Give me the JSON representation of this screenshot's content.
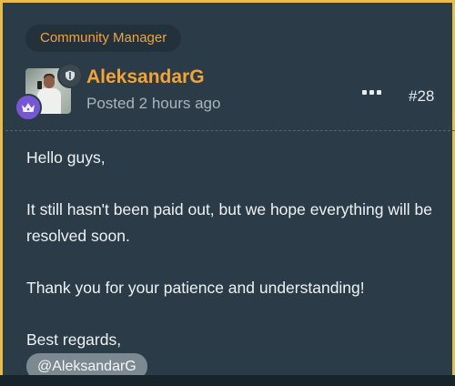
{
  "post": {
    "role_badge": "Community Manager",
    "author": "AleksandarG",
    "posted": "Posted 2 hours ago",
    "post_number": "#28",
    "body": {
      "greeting": "Hello guys,",
      "line1": "It still hasn't been paid out, but we hope everything will be resolved soon.",
      "line2": "Thank you for your patience and understanding!",
      "signoff": "Best regards,"
    },
    "mention": "@AleksandarG"
  },
  "colors": {
    "frame_border": "#e6bd4a",
    "background": "#2b3b47",
    "accent": "#f2a33a",
    "crown_badge": "#7657d3"
  },
  "icons": {
    "role": "shield-icon",
    "rank": "crown-icon",
    "menu": "more-options-icon"
  }
}
